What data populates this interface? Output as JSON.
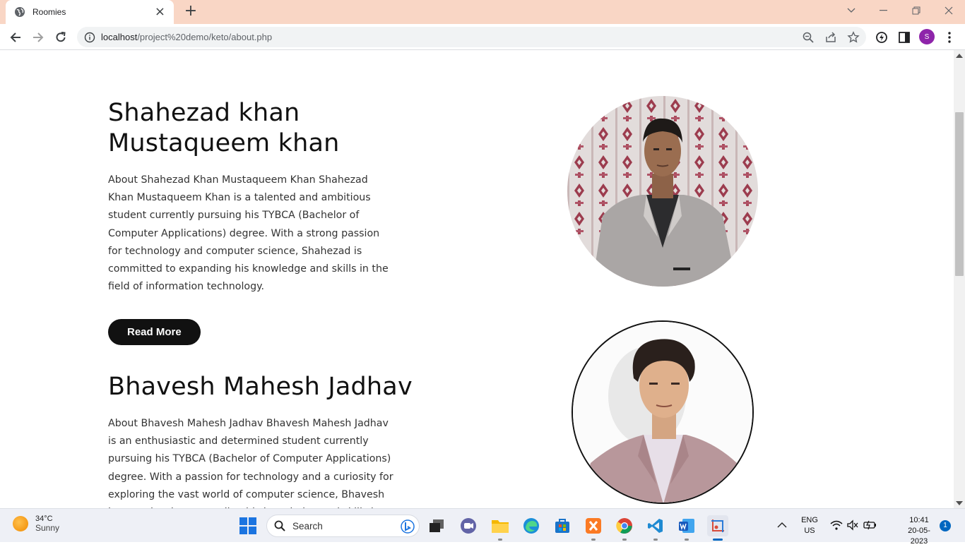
{
  "browser": {
    "tab_title": "Roomies",
    "url_host": "localhost",
    "url_path": "/project%20demo/keto/about.php",
    "profile_initial": "S"
  },
  "members": [
    {
      "name": "Shahezad khan Mustaqueem khan",
      "name_line1": "Shahezad khan",
      "name_line2": "Mustaqueem khan",
      "about": "About Shahezad Khan Mustaqueem Khan Shahezad Khan Mustaqueem Khan is a talented and ambitious student currently pursuing his TYBCA (Bachelor of Computer Applications) degree. With a strong passion for technology and computer science, Shahezad is committed to expanding his knowledge and skills in the field of information technology.",
      "button_label": "Read More"
    },
    {
      "name": "Bhavesh Mahesh Jadhav",
      "about": "About Bhavesh Mahesh Jadhav Bhavesh Mahesh Jadhav is an enthusiastic and determined student currently pursuing his TYBCA (Bachelor of Computer Applications) degree. With a passion for technology and a curiosity for exploring the vast world of computer science, Bhavesh is committed to expanding his knowledge and skills in the field of IT."
    }
  ],
  "taskbar": {
    "weather_temp": "34°C",
    "weather_condition": "Sunny",
    "search_label": "Search",
    "language_line1": "ENG",
    "language_line2": "US",
    "time": "10:41",
    "date": "20-05-2023",
    "notification_count": "1"
  }
}
